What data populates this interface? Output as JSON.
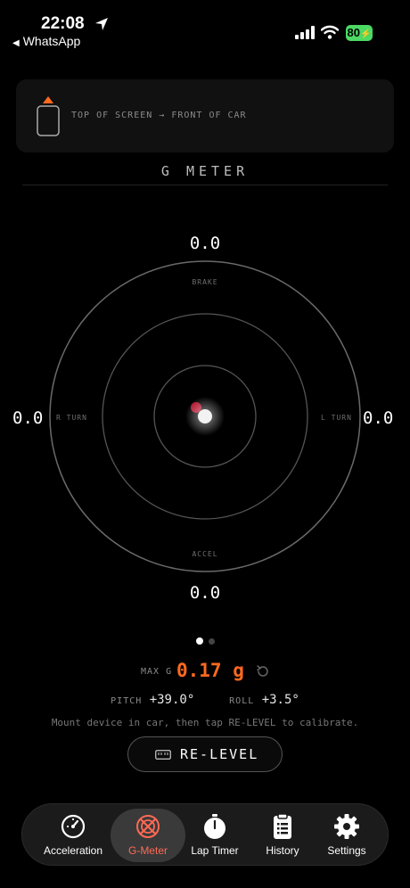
{
  "status": {
    "time": "22:08",
    "back_app": "WhatsApp",
    "battery": "80",
    "icons": [
      "location-arrow-icon",
      "cellular-signal-icon",
      "wifi-icon",
      "battery-charging-icon"
    ]
  },
  "orientation": {
    "badge": "END",
    "text": "TOP OF SCREEN → FRONT OF CAR"
  },
  "title": "G METER",
  "gauge": {
    "top_value": "0.0",
    "bottom_value": "0.0",
    "left_value": "0.0",
    "right_value": "0.0",
    "label_brake": "BRAKE",
    "label_accel": "ACCEL",
    "label_rturn": "R TURN",
    "label_lturn": "L TURN"
  },
  "pager": {
    "count": 2,
    "active": 0
  },
  "stats": {
    "max_g_label": "MAX G",
    "max_g_value": "0.17 g",
    "pitch_label": "PITCH",
    "pitch_value": "+39.0°",
    "roll_label": "ROLL",
    "roll_value": "+3.5°"
  },
  "hint": "Mount device in car, then tap RE-LEVEL to calibrate.",
  "relevel_label": "RE-LEVEL",
  "tabs": [
    {
      "label": "Acceleration",
      "icon": "speedometer-icon"
    },
    {
      "label": "G-Meter",
      "icon": "g-meter-icon",
      "active": true
    },
    {
      "label": "Lap Timer",
      "icon": "stopwatch-icon"
    },
    {
      "label": "History",
      "icon": "clipboard-list-icon"
    },
    {
      "label": "Settings",
      "icon": "gear-icon"
    }
  ],
  "colors": {
    "accent": "#ff6a1f",
    "active_tab": "#ff6a55",
    "dot_red": "#b0102a",
    "battery": "#4cd964"
  }
}
